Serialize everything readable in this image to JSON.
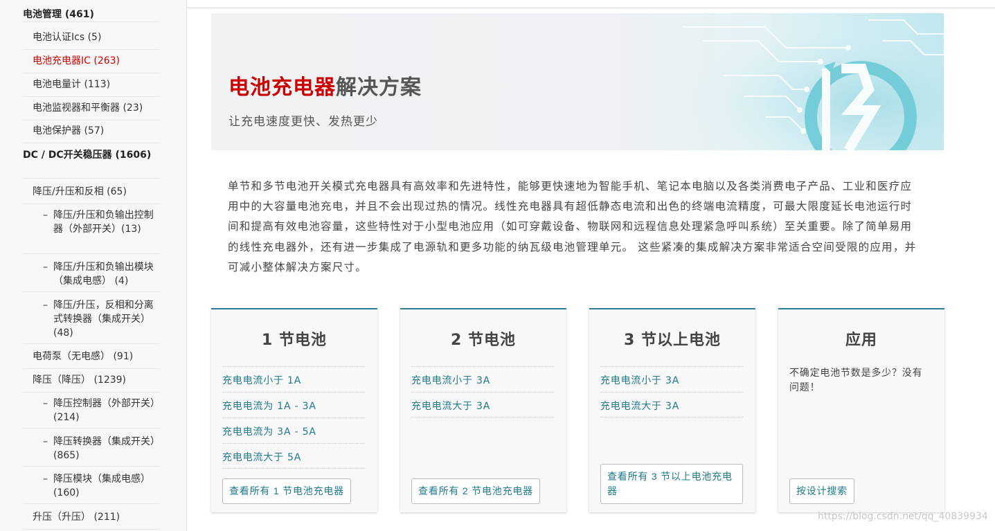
{
  "sidebar": {
    "items": [
      {
        "label": "电池管理 (461)",
        "level": 0
      },
      {
        "label": "电池认证Ics (5)",
        "level": 1
      },
      {
        "label": "电池充电器IC (263)",
        "level": 1,
        "active": true
      },
      {
        "label": "电池电量计 (113)",
        "level": 1
      },
      {
        "label": "电池监视器和平衡器 (23)",
        "level": 1
      },
      {
        "label": "电池保护器 (57)",
        "level": 1
      },
      {
        "label": "DC / DC开关稳压器 (1606)",
        "level": 0
      },
      {
        "label": "降压/升压和反相 (65)",
        "level": 1
      },
      {
        "label": "降压/升压和负输出控制器（外部开关）(13)",
        "level": 2
      },
      {
        "label": "降压/升压和负输出模块（集成电感） (4)",
        "level": 2
      },
      {
        "label": "降压/升压，反相和分离式转换器（集成开关） (48)",
        "level": 2
      },
      {
        "label": "电荷泵（无电感） (91)",
        "level": 1
      },
      {
        "label": "降压（降压） (1239)",
        "level": 1
      },
      {
        "label": "降压控制器（外部开关） (214)",
        "level": 2
      },
      {
        "label": "降压转换器（集成开关） (865)",
        "level": 2
      },
      {
        "label": "降压模块（集成电感） (160)",
        "level": 2
      },
      {
        "label": "升压（升压） (211)",
        "level": 1
      }
    ],
    "dash": "–"
  },
  "hero": {
    "title_red": "电池充电器",
    "title_rest": "解决方案",
    "subtitle": "让充电速度更快、发热更少"
  },
  "description": "单节和多节电池开关模式充电器具有高效率和先进特性，能够更快速地为智能手机、笔记本电脑以及各类消费电子产品、工业和医疗应用中的大容量电池充电，并且不会出现过热的情况。线性充电器具有超低静态电流和出色的终端电流精度，可最大限度延长电池运行时间和提高有效电池容量，这些特性对于小型电池应用（如可穿戴设备、物联网和远程信息处理紧急呼叫系统）至关重要。除了简单易用的线性充电器外，还有进一步集成了电源轨和更多功能的纳瓦级电池管理单元。 这些紧凑的集成解决方案非常适合空间受限的应用，并可减小整体解决方案尺寸。",
  "cards": [
    {
      "title": "1 节电池",
      "links": [
        "充电电流小于 1A",
        "充电电流为 1A - 3A",
        "充电电流为 3A - 5A",
        "充电电流大于 5A"
      ],
      "button": "查看所有 1 节电池充电器"
    },
    {
      "title": "2 节电池",
      "links": [
        "充电电流小于 3A",
        "充电电流大于 3A"
      ],
      "button": "查看所有 2 节电池充电器"
    },
    {
      "title": "3 节以上电池",
      "links": [
        "充电电流小于 3A",
        "充电电流大于 3A"
      ],
      "button": "查看所有 3 节以上电池充电器"
    },
    {
      "title": "应用",
      "text": "不确定电池节数是多少？没有问题！",
      "button": "按设计搜索"
    }
  ],
  "watermark": "https://blog.csdn.net/qq_40839934",
  "colors": {
    "accent_red": "#cc0000",
    "link_teal": "#1f7a8c",
    "card_border": "#2b7f93"
  }
}
